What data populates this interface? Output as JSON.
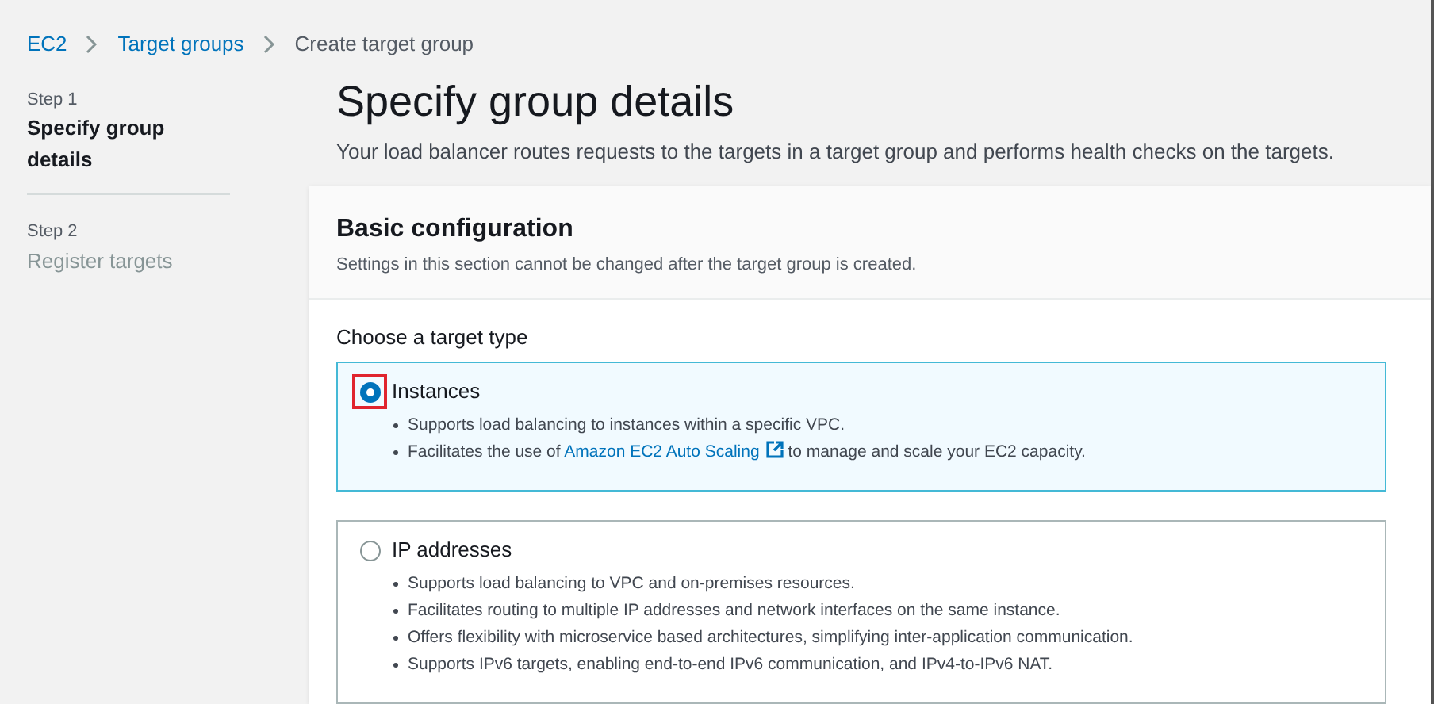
{
  "breadcrumbs": [
    {
      "label": "EC2",
      "kind": "link"
    },
    {
      "label": "Target groups",
      "kind": "link"
    },
    {
      "label": "Create target group",
      "kind": "current"
    }
  ],
  "steps": [
    {
      "step": "Step 1",
      "title": "Specify group details",
      "selected": true
    },
    {
      "step": "Step 2",
      "title": "Register targets",
      "selected": false
    }
  ],
  "page_title": "Specify group details",
  "page_description": "Your load balancer routes requests to the targets in a target group and performs health checks on the targets.",
  "card": {
    "title": "Basic configuration",
    "subtitle": "Settings in this section cannot be changed after the target group is created.",
    "field_label": "Choose a target type",
    "options": [
      {
        "label": "Instances",
        "selected": true,
        "highlighted": true,
        "bullets": [
          [
            {
              "kind": "text",
              "text": "Supports load balancing to instances within a specific VPC."
            }
          ],
          [
            {
              "kind": "text",
              "text": "Facilitates the use of "
            },
            {
              "kind": "external_link",
              "text": "Amazon EC2 Auto Scaling"
            },
            {
              "kind": "text",
              "text": " to manage and scale your EC2 capacity."
            }
          ]
        ]
      },
      {
        "label": "IP addresses",
        "selected": false,
        "highlighted": false,
        "bullets": [
          [
            {
              "kind": "text",
              "text": "Supports load balancing to VPC and on-premises resources."
            }
          ],
          [
            {
              "kind": "text",
              "text": "Facilitates routing to multiple IP addresses and network interfaces on the same instance."
            }
          ],
          [
            {
              "kind": "text",
              "text": "Offers flexibility with microservice based architectures, simplifying inter-application communication."
            }
          ],
          [
            {
              "kind": "text",
              "text": "Supports IPv6 targets, enabling end-to-end IPv6 communication, and IPv4-to-IPv6 NAT."
            }
          ]
        ]
      }
    ]
  }
}
